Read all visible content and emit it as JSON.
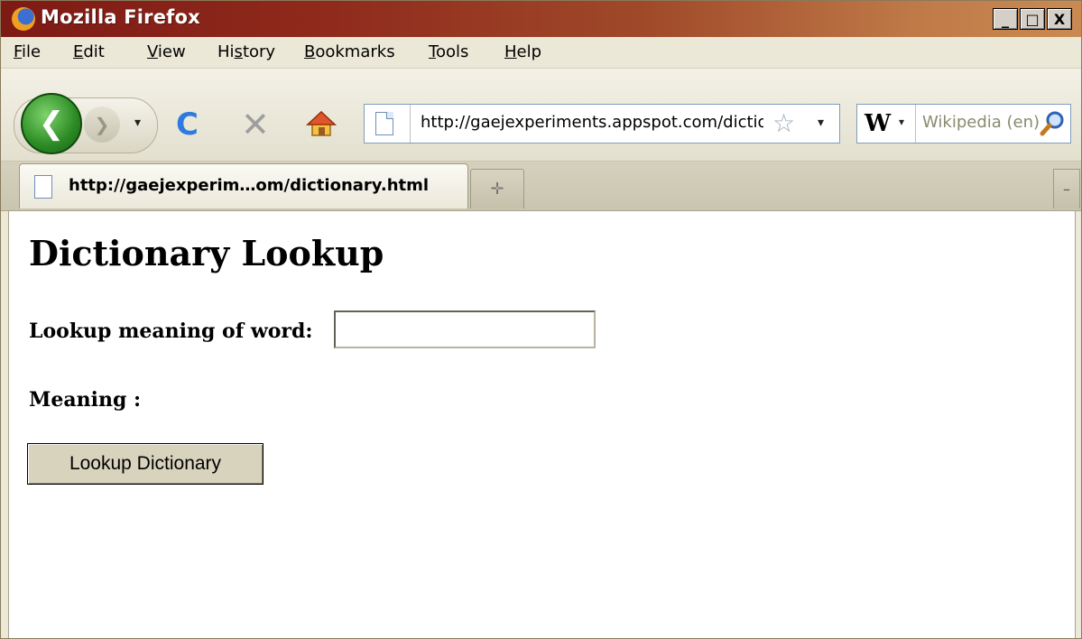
{
  "window": {
    "title": "Mozilla Firefox",
    "controls": {
      "minimize": "_",
      "maximize": "□",
      "close": "X"
    }
  },
  "menu": {
    "items": [
      {
        "pre": "",
        "key": "F",
        "post": "ile"
      },
      {
        "pre": "",
        "key": "E",
        "post": "dit"
      },
      {
        "pre": "",
        "key": "V",
        "post": "iew"
      },
      {
        "pre": "Hi",
        "key": "s",
        "post": "tory"
      },
      {
        "pre": "",
        "key": "B",
        "post": "ookmarks"
      },
      {
        "pre": "",
        "key": "T",
        "post": "ools"
      },
      {
        "pre": "",
        "key": "H",
        "post": "elp"
      }
    ]
  },
  "toolbar": {
    "back_glyph": "❮",
    "forward_glyph": "❯",
    "dropdown_glyph": "▾",
    "reload_glyph": "C",
    "stop_glyph": "✕",
    "url": "http://gaejexperiments.appspot.com/dictionary.html",
    "star_glyph": "☆",
    "search_engine_glyph": "W",
    "search_placeholder": "Wikipedia (en)"
  },
  "tabs": {
    "active_title": "http://gaejexperim…om/dictionary.html",
    "new_tab_glyph": "✛",
    "list_glyph": "–"
  },
  "page": {
    "heading": "Dictionary Lookup",
    "lookup_label": "Lookup meaning of word:",
    "word_value": "",
    "meaning_label": "Meaning :",
    "button_label": "Lookup Dictionary"
  },
  "colors": {
    "titlebar_start": "#7d1a14",
    "titlebar_end": "#c98a52",
    "back_button": "#2b8a24",
    "reload": "#2d7be0"
  }
}
